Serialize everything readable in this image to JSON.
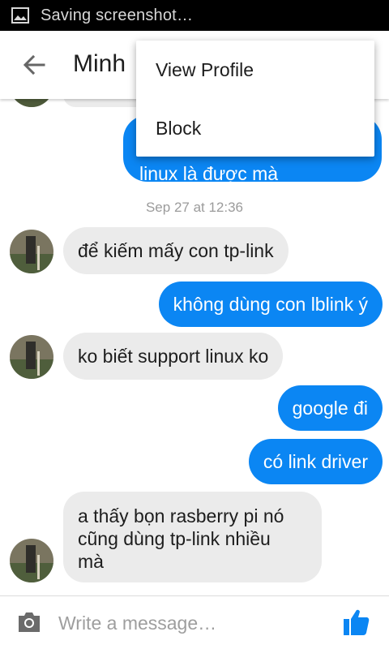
{
  "status_bar": {
    "text": "Saving screenshot…",
    "icon": "image-icon"
  },
  "app_bar": {
    "back_icon": "arrow-left-icon",
    "contact_name": "Minh"
  },
  "menu": {
    "items": [
      "View Profile",
      "Block"
    ]
  },
  "messages": {
    "partial_out_text": "linux là được mà",
    "timestamp": "Sep 27 at 12:36",
    "items": [
      {
        "direction": "in",
        "text": "để kiếm mấy con tp-link"
      },
      {
        "direction": "out",
        "text": "không dùng con lblink ý"
      },
      {
        "direction": "in",
        "text": "ko biết support linux ko"
      },
      {
        "direction": "out",
        "text": "google đi"
      },
      {
        "direction": "out",
        "text": "có link driver"
      },
      {
        "direction": "in",
        "lines": [
          "a thấy bọn rasberry pi nó",
          "cũng dùng tp-link nhiều",
          "mà"
        ]
      }
    ]
  },
  "composer": {
    "placeholder": "Write a message…",
    "camera_icon": "camera-icon",
    "like_icon": "thumbs-up-icon"
  },
  "colors": {
    "outgoing_bubble": "#0b86f3",
    "incoming_bubble": "#ebebeb",
    "accent": "#0b86f3"
  }
}
